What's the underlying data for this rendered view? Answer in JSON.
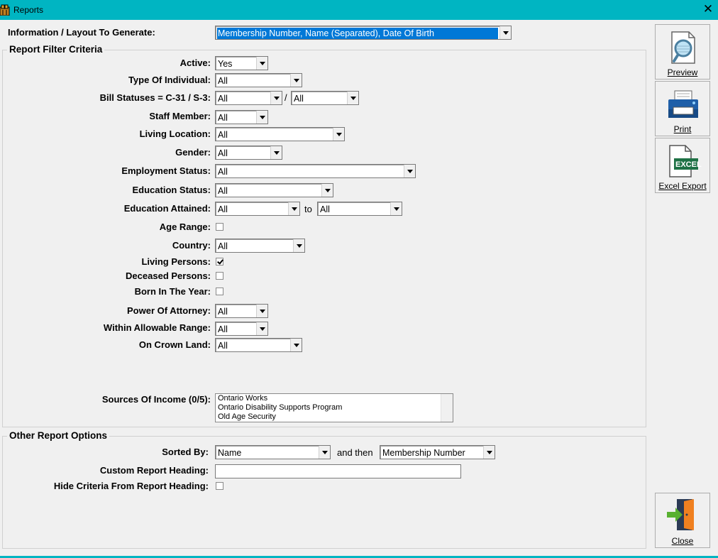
{
  "window": {
    "title": "Reports",
    "close_glyph": "✕"
  },
  "layout_label": "Information / Layout To Generate:",
  "layout_value": "Membership Number, Name (Separated), Date Of Birth",
  "filter_group": {
    "legend": "Report Filter Criteria",
    "active": {
      "label": "Active:",
      "value": "Yes"
    },
    "type_of_individual": {
      "label": "Type Of Individual:",
      "value": "All"
    },
    "bill_statuses": {
      "label": "Bill Statuses = C-31 / S-3:",
      "value1": "All",
      "separator": "/",
      "value2": "All"
    },
    "staff_member": {
      "label": "Staff Member:",
      "value": "All"
    },
    "living_location": {
      "label": "Living Location:",
      "value": "All"
    },
    "gender": {
      "label": "Gender:",
      "value": "All"
    },
    "employment_status": {
      "label": "Employment Status:",
      "value": "All"
    },
    "education_status": {
      "label": "Education Status:",
      "value": "All"
    },
    "education_attained": {
      "label": "Education Attained:",
      "from": "All",
      "to_label": "to",
      "to": "All"
    },
    "age_range": {
      "label": "Age Range:",
      "checked": false
    },
    "country": {
      "label": "Country:",
      "value": "All"
    },
    "living_persons": {
      "label": "Living Persons:",
      "checked": true
    },
    "deceased_persons": {
      "label": "Deceased Persons:",
      "checked": false
    },
    "born_in_year": {
      "label": "Born In The Year:",
      "checked": false
    },
    "power_of_attorney": {
      "label": "Power Of Attorney:",
      "value": "All"
    },
    "within_allowable_range": {
      "label": "Within Allowable Range:",
      "value": "All"
    },
    "on_crown_land": {
      "label": "On Crown Land:",
      "value": "All"
    },
    "sources_of_income": {
      "label": "Sources Of Income (0/5):",
      "items": [
        "Ontario Works",
        "Ontario Disability Supports Program",
        "Old Age Security"
      ]
    }
  },
  "options_group": {
    "legend": "Other Report Options",
    "sorted_by": {
      "label": "Sorted By:",
      "value": "Name",
      "then_label": "and then",
      "then_value": "Membership Number"
    },
    "custom_heading": {
      "label": "Custom Report Heading:",
      "value": ""
    },
    "hide_criteria": {
      "label": "Hide Criteria From Report Heading:",
      "checked": false
    }
  },
  "buttons": {
    "preview": {
      "label": "Preview",
      "icon": "magnifier-document-icon"
    },
    "print": {
      "label": "Print",
      "icon": "printer-icon"
    },
    "excel_export": {
      "label": "Excel Export",
      "icon": "excel-file-icon",
      "badge": "EXCEL"
    },
    "close": {
      "label": "Close",
      "icon": "exit-door-icon"
    }
  },
  "colors": {
    "titlebar": "#00b5c2",
    "client": "#f0f0f0",
    "selection": "#0078d7",
    "excel_green": "#1e7145"
  }
}
